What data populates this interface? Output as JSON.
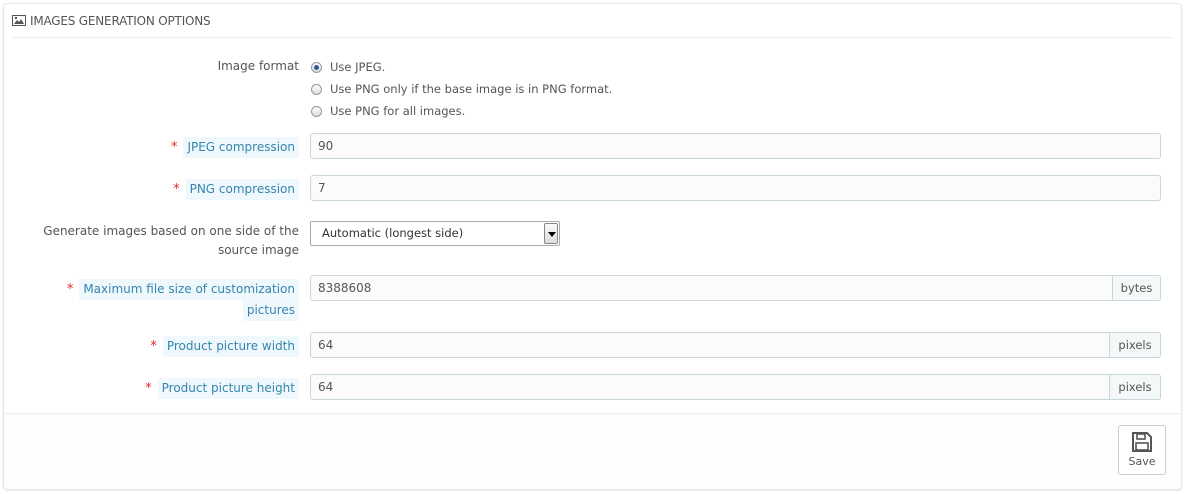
{
  "panel": {
    "title": "IMAGES GENERATION OPTIONS",
    "icon": "image-icon"
  },
  "image_format": {
    "label": "Image format",
    "options": [
      {
        "label": "Use JPEG.",
        "selected": true
      },
      {
        "label": "Use PNG only if the base image is in PNG format.",
        "selected": false
      },
      {
        "label": "Use PNG for all images.",
        "selected": false
      }
    ]
  },
  "jpeg_compression": {
    "required": "*",
    "label": "JPEG compression",
    "value": "90"
  },
  "png_compression": {
    "required": "*",
    "label": "PNG compression",
    "value": "7"
  },
  "generate_side": {
    "label_line1": "Generate images based on one side of the",
    "label_line2": "source image",
    "selected": "Automatic (longest side)"
  },
  "max_file_size": {
    "required": "*",
    "label_line1": "Maximum file size of customization",
    "label_line2": "pictures",
    "value": "8388608",
    "unit": "bytes"
  },
  "product_width": {
    "required": "*",
    "label": "Product picture width",
    "value": "64",
    "unit": "pixels"
  },
  "product_height": {
    "required": "*",
    "label": "Product picture height",
    "value": "64",
    "unit": "pixels"
  },
  "footer": {
    "save_label": "Save",
    "save_icon": "floppy-disk-icon"
  }
}
